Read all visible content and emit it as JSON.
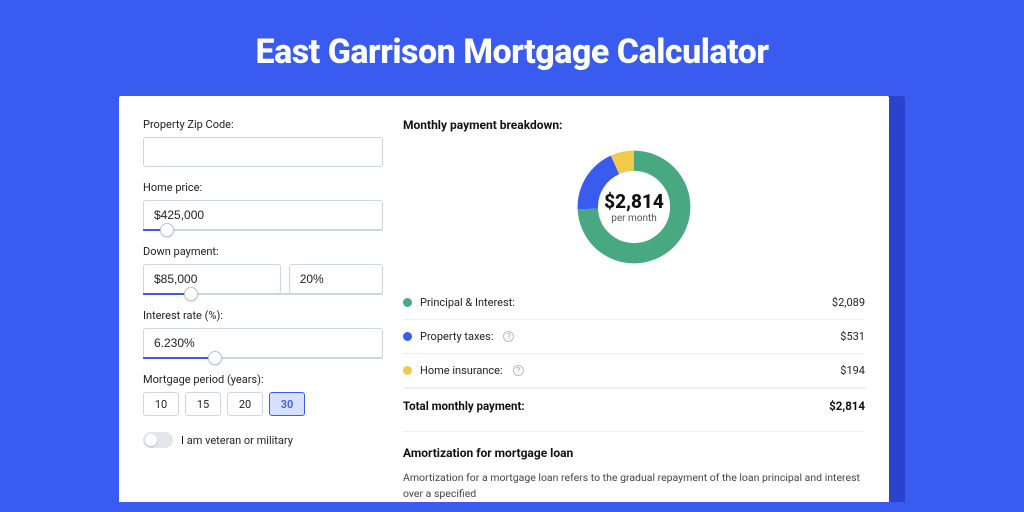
{
  "colors": {
    "principal": "#48a882",
    "taxes": "#3a5bf0",
    "insurance": "#f2ca4b"
  },
  "hero": {
    "title": "East Garrison Mortgage Calculator"
  },
  "form": {
    "zip": {
      "label": "Property Zip Code:",
      "value": ""
    },
    "home_price": {
      "label": "Home price:",
      "value": "$425,000",
      "slider_pct": 10
    },
    "down_payment": {
      "label": "Down payment:",
      "value": "$85,000",
      "pct": "20%",
      "slider_pct": 20
    },
    "interest": {
      "label": "Interest rate (%):",
      "value": "6.230%",
      "slider_pct": 30
    },
    "period": {
      "label": "Mortgage period (years):",
      "options": [
        "10",
        "15",
        "20",
        "30"
      ],
      "active": "30"
    },
    "veteran": {
      "label": "I am veteran or military"
    }
  },
  "breakdown": {
    "title": "Monthly payment breakdown:",
    "amount": "$2,814",
    "sub": "per month",
    "items": [
      {
        "label": "Principal & Interest:",
        "value": "$2,089",
        "color_key": "principal",
        "has_info": false
      },
      {
        "label": "Property taxes:",
        "value": "$531",
        "color_key": "taxes",
        "has_info": true
      },
      {
        "label": "Home insurance:",
        "value": "$194",
        "color_key": "insurance",
        "has_info": true
      }
    ],
    "total_label": "Total monthly payment:",
    "total_value": "$2,814"
  },
  "amort": {
    "title": "Amortization for mortgage loan",
    "text": "Amortization for a mortgage loan refers to the gradual repayment of the loan principal and interest over a specified"
  },
  "chart_data": {
    "type": "pie",
    "title": "Monthly payment breakdown",
    "series": [
      {
        "name": "Principal & Interest",
        "value": 2089
      },
      {
        "name": "Property taxes",
        "value": 531
      },
      {
        "name": "Home insurance",
        "value": 194
      }
    ],
    "total": 2814,
    "unit": "$ per month"
  }
}
